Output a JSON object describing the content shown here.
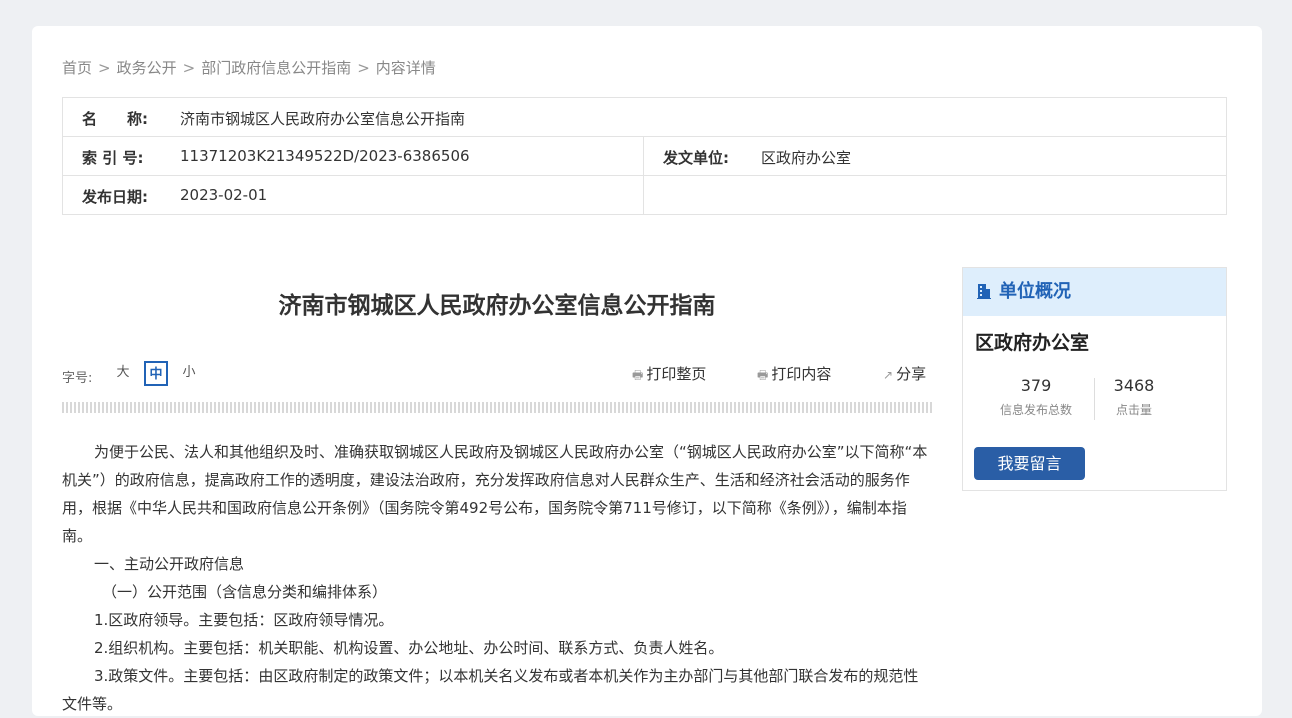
{
  "breadcrumb": {
    "items": [
      "首页",
      "政务公开",
      "部门政府信息公开指南",
      "内容详情"
    ],
    "separator": ">"
  },
  "meta": {
    "name_label": "名　　称:",
    "name_value": "济南市钢城区人民政府办公室信息公开指南",
    "index_label": "索 引 号:",
    "index_value": "11371203K21349522D/2023-6386506",
    "issuer_label": "发文单位:",
    "issuer_value": "区政府办公室",
    "date_label": "发布日期:",
    "date_value": "2023-02-01"
  },
  "article": {
    "title": "济南市钢城区人民政府办公室信息公开指南",
    "paragraphs": [
      "为便于公民、法人和其他组织及时、准确获取钢城区人民政府及钢城区人民政府办公室（“钢城区人民政府办公室”以下简称“本机关”）的政府信息，提高政府工作的透明度，建设法治政府，充分发挥政府信息对人民群众生产、生活和经济社会活动的服务作用，根据《中华人民共和国政府信息公开条例》（国务院令第492号公布，国务院令第711号修订，以下简称《条例》），编制本指南。",
      "一、主动公开政府信息",
      "（一）公开范围（含信息分类和编排体系）",
      "1.区政府领导。主要包括：区政府领导情况。",
      "2.组织机构。主要包括：机关职能、机构设置、办公地址、办公时间、联系方式、负责人姓名。",
      "3.政策文件。主要包括：由区政府制定的政策文件；以本机关名义发布或者本机关作为主办部门与其他部门联合发布的规范性文件等。"
    ]
  },
  "toolbar": {
    "font_size_label": "字号:",
    "font_large": "大",
    "font_medium": "中",
    "font_small": "小",
    "print_page": "打印整页",
    "print_content": "打印内容",
    "share": "分享"
  },
  "sidebar": {
    "title": "单位概况",
    "unit_name": "区政府办公室",
    "stats": [
      {
        "value": "379",
        "caption": "信息发布总数"
      },
      {
        "value": "3468",
        "caption": "点击量"
      }
    ],
    "message_button": "我要留言"
  },
  "colors": {
    "accent": "#2163b6",
    "button": "#2a5ea6",
    "sidebar_header_bg": "#deeefc"
  }
}
